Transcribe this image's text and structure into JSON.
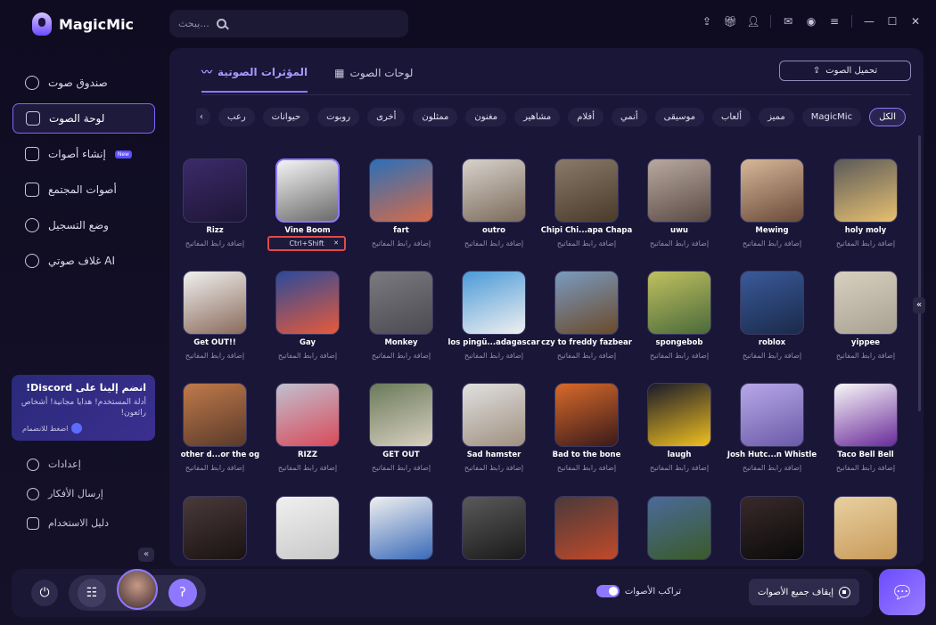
{
  "app": {
    "name": "MagicMic"
  },
  "search": {
    "placeholder": "...يبحث"
  },
  "sidebar": {
    "items": [
      {
        "label": "صندوق صوت",
        "icon": "mic-icon"
      },
      {
        "label": "لوحة الصوت",
        "icon": "soundboard-icon",
        "active": true
      },
      {
        "label": "إنشاء أصوات",
        "icon": "cube-icon",
        "badge": "New"
      },
      {
        "label": "أصوات المجتمع",
        "icon": "music-note-icon"
      },
      {
        "label": "وضع التسجيل",
        "icon": "record-icon"
      },
      {
        "label": "غلاف صوتي AI",
        "icon": "ai-cover-icon"
      }
    ]
  },
  "discord": {
    "title": "انضم إلينا على Discord!",
    "desc": "أدلة المستخدم! هدايا مجانية! أشخاص رائعون!",
    "join": "اضغط للانضمام"
  },
  "bottom_nav": [
    {
      "label": "إعدادات"
    },
    {
      "label": "إرسال الأفكار"
    },
    {
      "label": "دليل الاستخدام"
    }
  ],
  "tabs": [
    {
      "label": "المؤثرات الصوتية",
      "active": true
    },
    {
      "label": "لوحات الصوت"
    }
  ],
  "upload_label": "تحميل الصوت",
  "categories": [
    "الكل",
    "MagicMic",
    "مميز",
    "ألعاب",
    "موسيقى",
    "أنمي",
    "أفلام",
    "مشاهير",
    "مغنون",
    "ممثلون",
    "أخرى",
    "روبوت",
    "حيوانات",
    "رعب"
  ],
  "sound_hint": "إضافة رابط المفاتيح",
  "hotkey": "Ctrl+Shift",
  "sounds": [
    {
      "name": "Rizz",
      "c1": "#3b2a6a",
      "c2": "#1e1636"
    },
    {
      "name": "Vine Boom",
      "c1": "#f4f4f4",
      "c2": "#6a6a6a"
    },
    {
      "name": "fart",
      "c1": "#2b6fb8",
      "c2": "#d76b48"
    },
    {
      "name": "outro",
      "c1": "#d8d2cc",
      "c2": "#7a6a5a"
    },
    {
      "name": "Chipi Chi...apa Chapa",
      "c1": "#8a7a6a",
      "c2": "#4a3a2a"
    },
    {
      "name": "uwu",
      "c1": "#b8a9a0",
      "c2": "#5a4a44"
    },
    {
      "name": "Mewing",
      "c1": "#d6b898",
      "c2": "#6a4a3a"
    },
    {
      "name": "holy moly",
      "c1": "#5a5a5a",
      "c2": "#e8c070"
    },
    {
      "name": "Get OUT!!",
      "c1": "#f0f0f0",
      "c2": "#8a6a5a"
    },
    {
      "name": "Gay",
      "c1": "#2a4a9a",
      "c2": "#e85a3a"
    },
    {
      "name": "Monkey",
      "c1": "#7a7a80",
      "c2": "#4a4a50"
    },
    {
      "name": "los pingü...adagascar",
      "c1": "#4a9ad8",
      "c2": "#f0f0f0"
    },
    {
      "name": "czy to freddy fazbear",
      "c1": "#7a9ac0",
      "c2": "#6a4a2a"
    },
    {
      "name": "spongebob",
      "c1": "#c0c060",
      "c2": "#4a6a3a"
    },
    {
      "name": "roblox",
      "c1": "#3a5a9a",
      "c2": "#1a2a4a"
    },
    {
      "name": "yippee",
      "c1": "#d8d0c0",
      "c2": "#a8a090"
    },
    {
      "name": "another d...or the og",
      "c1": "#c07a4a",
      "c2": "#5a3a2a"
    },
    {
      "name": "RIZZ",
      "c1": "#c0c0d0",
      "c2": "#d84a5a"
    },
    {
      "name": "GET OUT",
      "c1": "#6a7a5a",
      "c2": "#d8d0c0"
    },
    {
      "name": "Sad hamster",
      "c1": "#e0e0e0",
      "c2": "#a09080"
    },
    {
      "name": "Bad to the bone",
      "c1": "#d86a2a",
      "c2": "#3a1a1a"
    },
    {
      "name": "laugh",
      "c1": "#1a1a2a",
      "c2": "#f0c020"
    },
    {
      "name": "Josh Hutc...n Whistle",
      "c1": "#b8a8e8",
      "c2": "#6a5aa8"
    },
    {
      "name": "Taco Bell Bell",
      "c1": "#f8f8f8",
      "c2": "#6a2a9a"
    },
    {
      "name": "",
      "c1": "#4a3a3a",
      "c2": "#1a1212"
    },
    {
      "name": "",
      "c1": "#f0f0f0",
      "c2": "#c8c8c8"
    },
    {
      "name": "",
      "c1": "#f0f0f0",
      "c2": "#3a6ab8"
    },
    {
      "name": "",
      "c1": "#5a5a5a",
      "c2": "#1a1a1a"
    },
    {
      "name": "",
      "c1": "#4a3a3a",
      "c2": "#c04a2a"
    },
    {
      "name": "",
      "c1": "#4a6a9a",
      "c2": "#3a5a2a"
    },
    {
      "name": "",
      "c1": "#3a2a2a",
      "c2": "#0a0a0a"
    },
    {
      "name": "",
      "c1": "#e8d0a0",
      "c2": "#c89a5a"
    }
  ],
  "bottombar": {
    "overlap_label": "تراكب الأصوات",
    "stop_label": "إيقاف جميع الأصوات"
  },
  "colors": {
    "accent": "#8f78ff",
    "hotkey_border": "#e04a4a"
  }
}
